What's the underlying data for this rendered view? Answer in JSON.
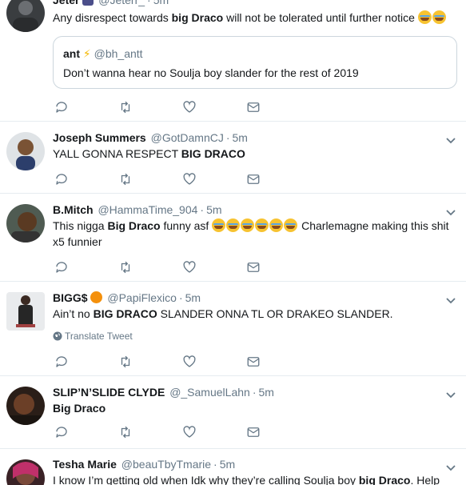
{
  "tweets": [
    {
      "name": "Jeter",
      "handle": "@Jeterr_",
      "time": "5m",
      "text_a": "Any disrespect towards ",
      "text_bold": "big Draco",
      "text_b": " will not be tolerated until further notice",
      "quote": {
        "name": "ant",
        "handle": "@bh_antt",
        "text": "Don’t wanna hear no Soulja boy slander for the rest of 2019"
      }
    },
    {
      "name": "Joseph Summers",
      "handle": "@GotDamnCJ",
      "time": "5m",
      "text_a": "YALL GONNA RESPECT ",
      "text_bold": "BIG DRACO"
    },
    {
      "name": "B.Mitch",
      "handle": "@HammaTime_904",
      "time": "5m",
      "text_a": "This nigga ",
      "text_bold": "Big Draco",
      "text_b": " funny asf",
      "text_c": " Charlemagne making this shit",
      "text_d": "x5 funnier"
    },
    {
      "name": "BIGG$",
      "handle": "@PapiFlexico",
      "time": "5m",
      "text_a": "Ain’t no ",
      "text_bold": "BIG DRACO",
      "text_b": " SLANDER ONNA TL OR DRAKEO SLANDER.",
      "translate": "Translate Tweet"
    },
    {
      "name": "SLIP’N’SLIDE CLYDE",
      "handle": "@_SamuelLahn",
      "time": "5m",
      "text_bold": "Big Draco"
    },
    {
      "name": "Tesha Marie",
      "handle": "@beauTbyTmarie",
      "time": "5m",
      "text_a": "I know I’m getting old when Idk why they’re calling Soulja boy ",
      "text_bold": "big Draco",
      "text_b": ". Help"
    }
  ],
  "separator": "·",
  "colors": {
    "text": "#14171a",
    "secondary": "#657786",
    "icon": "#657786",
    "border": "#e6ecf0"
  },
  "icons": [
    "reply-icon",
    "retweet-icon",
    "like-icon",
    "message-icon",
    "chevron-down-icon",
    "globe-icon",
    "emoji-face-tears-of-joy",
    "lightning-emoji",
    "orange-emoji",
    "ninja-emoji"
  ]
}
